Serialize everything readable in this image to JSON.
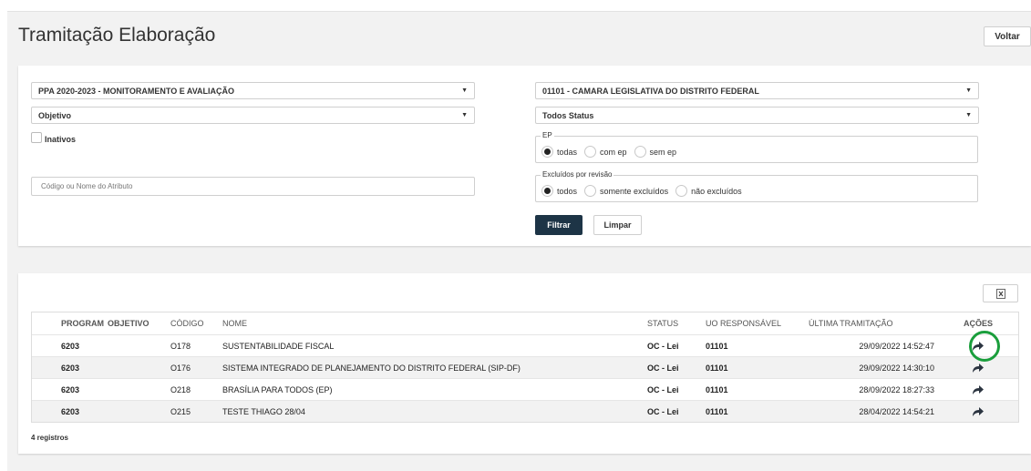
{
  "header": {
    "title": "Tramitação Elaboração",
    "voltar_label": "Voltar"
  },
  "filters": {
    "ppa_select": "PPA 2020-2023 - MONITORAMENTO E AVALIAÇÃO",
    "tipo_select": "Objetivo",
    "inativos_label": "Inativos",
    "search_placeholder": "Código ou Nome do Atributo",
    "uo_select": "01101 - CAMARA LEGISLATIVA DO DISTRITO FEDERAL",
    "status_select": "Todos Status",
    "ep": {
      "legend": "EP",
      "options": [
        "todas",
        "com ep",
        "sem ep"
      ],
      "selected": "todas"
    },
    "excluidos": {
      "legend": "Excluídos por revisão",
      "options": [
        "todos",
        "somente excluídos",
        "não excluídos"
      ],
      "selected": "todos"
    },
    "filtrar_label": "Filtrar",
    "limpar_label": "Limpar"
  },
  "table": {
    "headers": [
      "PROGRAMA",
      "OBJETIVO",
      "CÓDIGO",
      "NOME",
      "STATUS",
      "UO RESPONSÁVEL",
      "ÚLTIMA TRAMITAÇÃO",
      "AÇÕES"
    ],
    "rows": [
      {
        "programa": "6203",
        "objetivo": "",
        "codigo": "O178",
        "nome": "SUSTENTABILIDADE FISCAL",
        "status": "OC - Lei",
        "uo": "01101",
        "ultima": "29/09/2022 14:52:47"
      },
      {
        "programa": "6203",
        "objetivo": "",
        "codigo": "O176",
        "nome": "SISTEMA INTEGRADO DE PLANEJAMENTO DO DISTRITO FEDERAL (SIP-DF)",
        "status": "OC - Lei",
        "uo": "01101",
        "ultima": "29/09/2022 14:30:10"
      },
      {
        "programa": "6203",
        "objetivo": "",
        "codigo": "O218",
        "nome": "BRASÍLIA PARA TODOS (EP)",
        "status": "OC - Lei",
        "uo": "01101",
        "ultima": "28/09/2022 18:27:33"
      },
      {
        "programa": "6203",
        "objetivo": "",
        "codigo": "O215",
        "nome": "TESTE THIAGO 28/04",
        "status": "OC - Lei",
        "uo": "01101",
        "ultima": "28/04/2022 14:54:21"
      }
    ],
    "count_label": "4 registros"
  },
  "icons": {
    "tramitar": "share-arrow-icon",
    "export": "excel-export-icon",
    "caret": "chevron-down-icon"
  },
  "colors": {
    "primary_button": "#1d3446",
    "highlight": "#1a9e3c"
  }
}
